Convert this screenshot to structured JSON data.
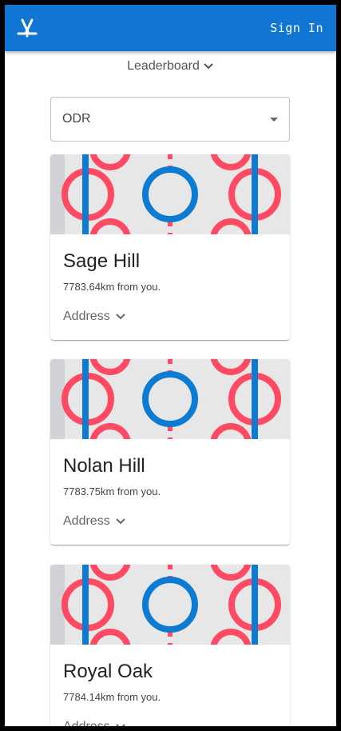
{
  "header": {
    "logo_icon": "hockey-sticks-icon",
    "signin_label": "Sign In",
    "color": "#1176d3"
  },
  "leaderboard": {
    "label": "Leaderboard",
    "icon": "chevron-down-icon"
  },
  "filter": {
    "selected": "ODR",
    "icon": "dropdown-arrow-icon"
  },
  "rinks": [
    {
      "name": "Sage Hill",
      "distance": "7783.64km from you.",
      "address_label": "Address"
    },
    {
      "name": "Nolan Hill",
      "distance": "7783.75km from you.",
      "address_label": "Address"
    },
    {
      "name": "Royal Oak",
      "distance": "7784.14km from you.",
      "address_label": "Address"
    }
  ],
  "colors": {
    "rink_red": "#ff4a63",
    "rink_blue": "#0d7bd1",
    "rink_ice": "#e7e7e7",
    "rink_board": "#d2d2d6"
  }
}
